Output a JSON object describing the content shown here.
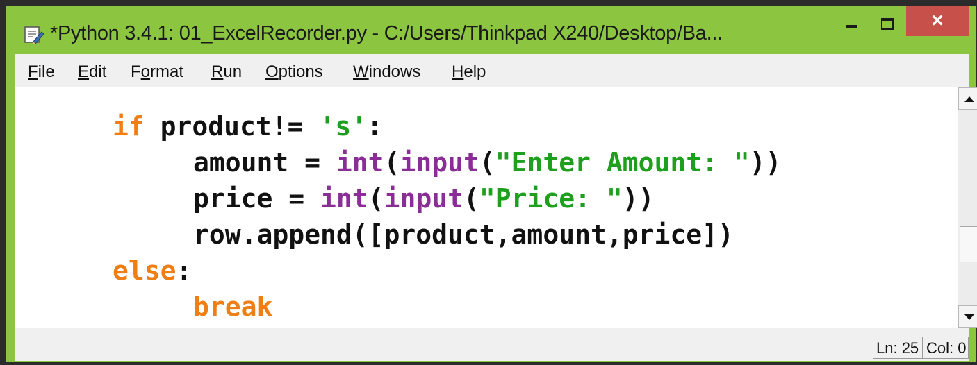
{
  "window": {
    "title": "*Python 3.4.1: 01_ExcelRecorder.py - C:/Users/Thinkpad X240/Desktop/Ba...",
    "close_label": "×",
    "accent_color": "#8cc540",
    "close_color": "#c7504a"
  },
  "menu": {
    "items": [
      {
        "pre": "",
        "acc": "F",
        "post": "ile"
      },
      {
        "pre": "",
        "acc": "E",
        "post": "dit"
      },
      {
        "pre": "F",
        "acc": "o",
        "post": "rmat"
      },
      {
        "pre": "",
        "acc": "R",
        "post": "un"
      },
      {
        "pre": "",
        "acc": "O",
        "post": "ptions"
      },
      {
        "pre": "",
        "acc": "W",
        "post": "indows"
      },
      {
        "pre": "",
        "acc": "H",
        "post": "elp"
      }
    ]
  },
  "editor": {
    "syntax_colors": {
      "keyword": "#ef7e15",
      "builtin": "#8a2d97",
      "string": "#1ea01e",
      "default": "#111111"
    },
    "lines": [
      [
        {
          "t": "if",
          "c": "kw"
        },
        {
          "t": " product!= ",
          "c": ""
        },
        {
          "t": "'s'",
          "c": "str"
        },
        {
          "t": ":",
          "c": ""
        }
      ],
      [
        {
          "t": "amount = ",
          "c": ""
        },
        {
          "t": "int",
          "c": "bi"
        },
        {
          "t": "(",
          "c": ""
        },
        {
          "t": "input",
          "c": "bi"
        },
        {
          "t": "(",
          "c": ""
        },
        {
          "t": "\"Enter Amount: \"",
          "c": "str"
        },
        {
          "t": "))",
          "c": ""
        }
      ],
      [
        {
          "t": "price = ",
          "c": ""
        },
        {
          "t": "int",
          "c": "bi"
        },
        {
          "t": "(",
          "c": ""
        },
        {
          "t": "input",
          "c": "bi"
        },
        {
          "t": "(",
          "c": ""
        },
        {
          "t": "\"Price: \"",
          "c": "str"
        },
        {
          "t": "))",
          "c": ""
        }
      ],
      [
        {
          "t": "row.append([product,amount,price])",
          "c": ""
        }
      ],
      [
        {
          "t": "else",
          "c": "kw"
        },
        {
          "t": ":",
          "c": ""
        }
      ],
      [
        {
          "t": "break",
          "c": "kw"
        }
      ]
    ]
  },
  "status": {
    "line": "Ln: 25",
    "col": "Col: 0"
  }
}
